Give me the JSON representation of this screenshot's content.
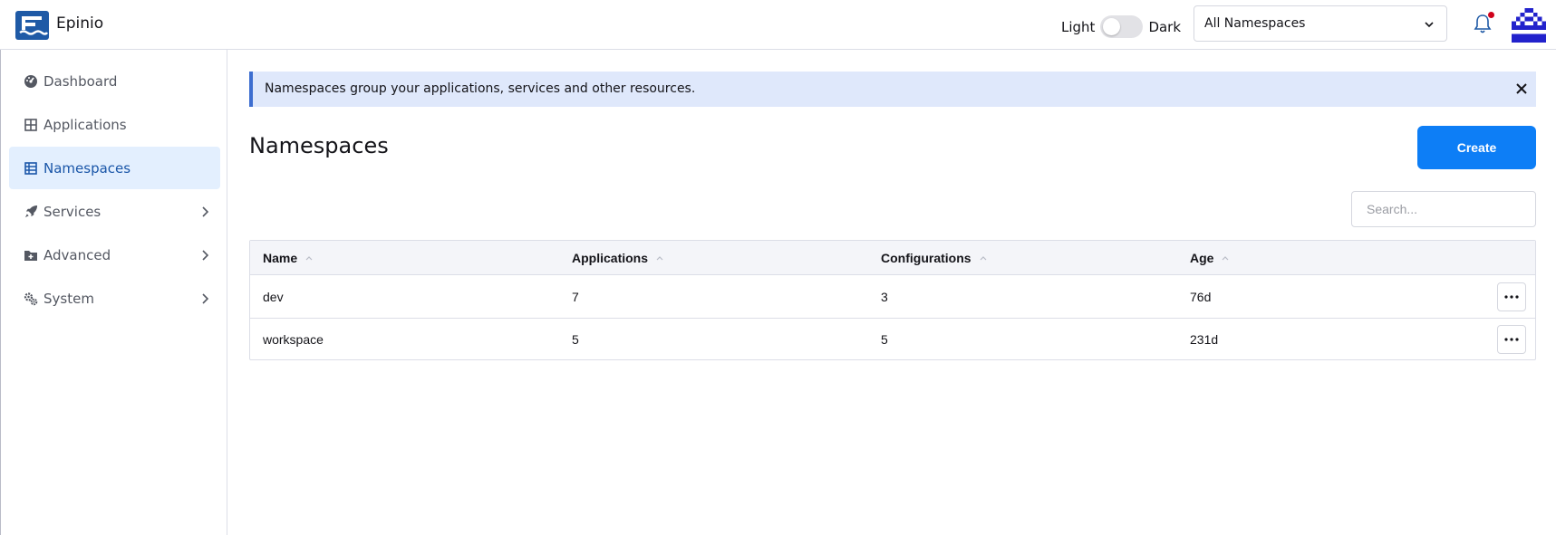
{
  "header": {
    "app_name": "Epinio",
    "theme_light": "Light",
    "theme_dark": "Dark",
    "namespace_selected": "All Namespaces",
    "brand_color": "#1f5aa6",
    "notification_dot_color": "#d0021b"
  },
  "sidebar": {
    "items": [
      {
        "label": "Dashboard",
        "icon": "dashboard-icon"
      },
      {
        "label": "Applications",
        "icon": "grid-icon"
      },
      {
        "label": "Namespaces",
        "icon": "list-icon",
        "active": true
      },
      {
        "label": "Services",
        "icon": "rocket-icon",
        "expandable": true
      },
      {
        "label": "Advanced",
        "icon": "folder-plus-icon",
        "expandable": true
      },
      {
        "label": "System",
        "icon": "gears-icon",
        "expandable": true
      }
    ]
  },
  "main": {
    "banner_text": "Namespaces group your applications, services and other resources.",
    "title": "Namespaces",
    "create_label": "Create",
    "search_placeholder": "Search...",
    "accent_color": "#0d7ef6"
  },
  "table": {
    "columns": [
      "Name",
      "Applications",
      "Configurations",
      "Age"
    ],
    "rows": [
      [
        "dev",
        "7",
        "3",
        "76d"
      ],
      [
        "workspace",
        "5",
        "5",
        "231d"
      ]
    ]
  }
}
